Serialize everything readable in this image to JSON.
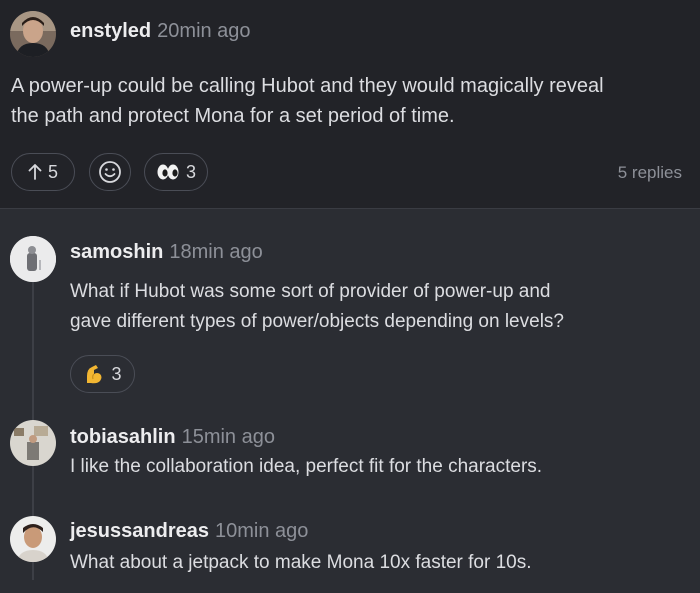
{
  "main_post": {
    "author": "enstyled",
    "time": "20min ago",
    "text_line1": "A power-up could be calling Hubot and they would magically reveal",
    "text_line2": "the path and protect Mona for a set period of time.",
    "upvote_count": "5",
    "add_reaction_icon": "smiley-icon",
    "eyes_count": "3",
    "replies": "5 replies"
  },
  "replies": [
    {
      "author": "samoshin",
      "time": "18min ago",
      "text_line1": "What if Hubot was some sort of provider of power-up and",
      "text_line2": "gave different types of power/objects depending on levels?",
      "reaction_icon": "flexed-biceps-icon",
      "reaction_count": "3"
    },
    {
      "author": "tobiasahlin",
      "time": "15min ago",
      "text_line1": "I like the collaboration idea, perfect fit for the characters."
    },
    {
      "author": "jesussandreas",
      "time": "10min ago",
      "text_line1": "What about a jetpack to make Mona 10x faster for 10s."
    }
  ],
  "colors": {
    "background": "#2b2d33",
    "post_background": "#222328",
    "pill_border": "#4a4d56",
    "muted_text": "#8d9098"
  }
}
